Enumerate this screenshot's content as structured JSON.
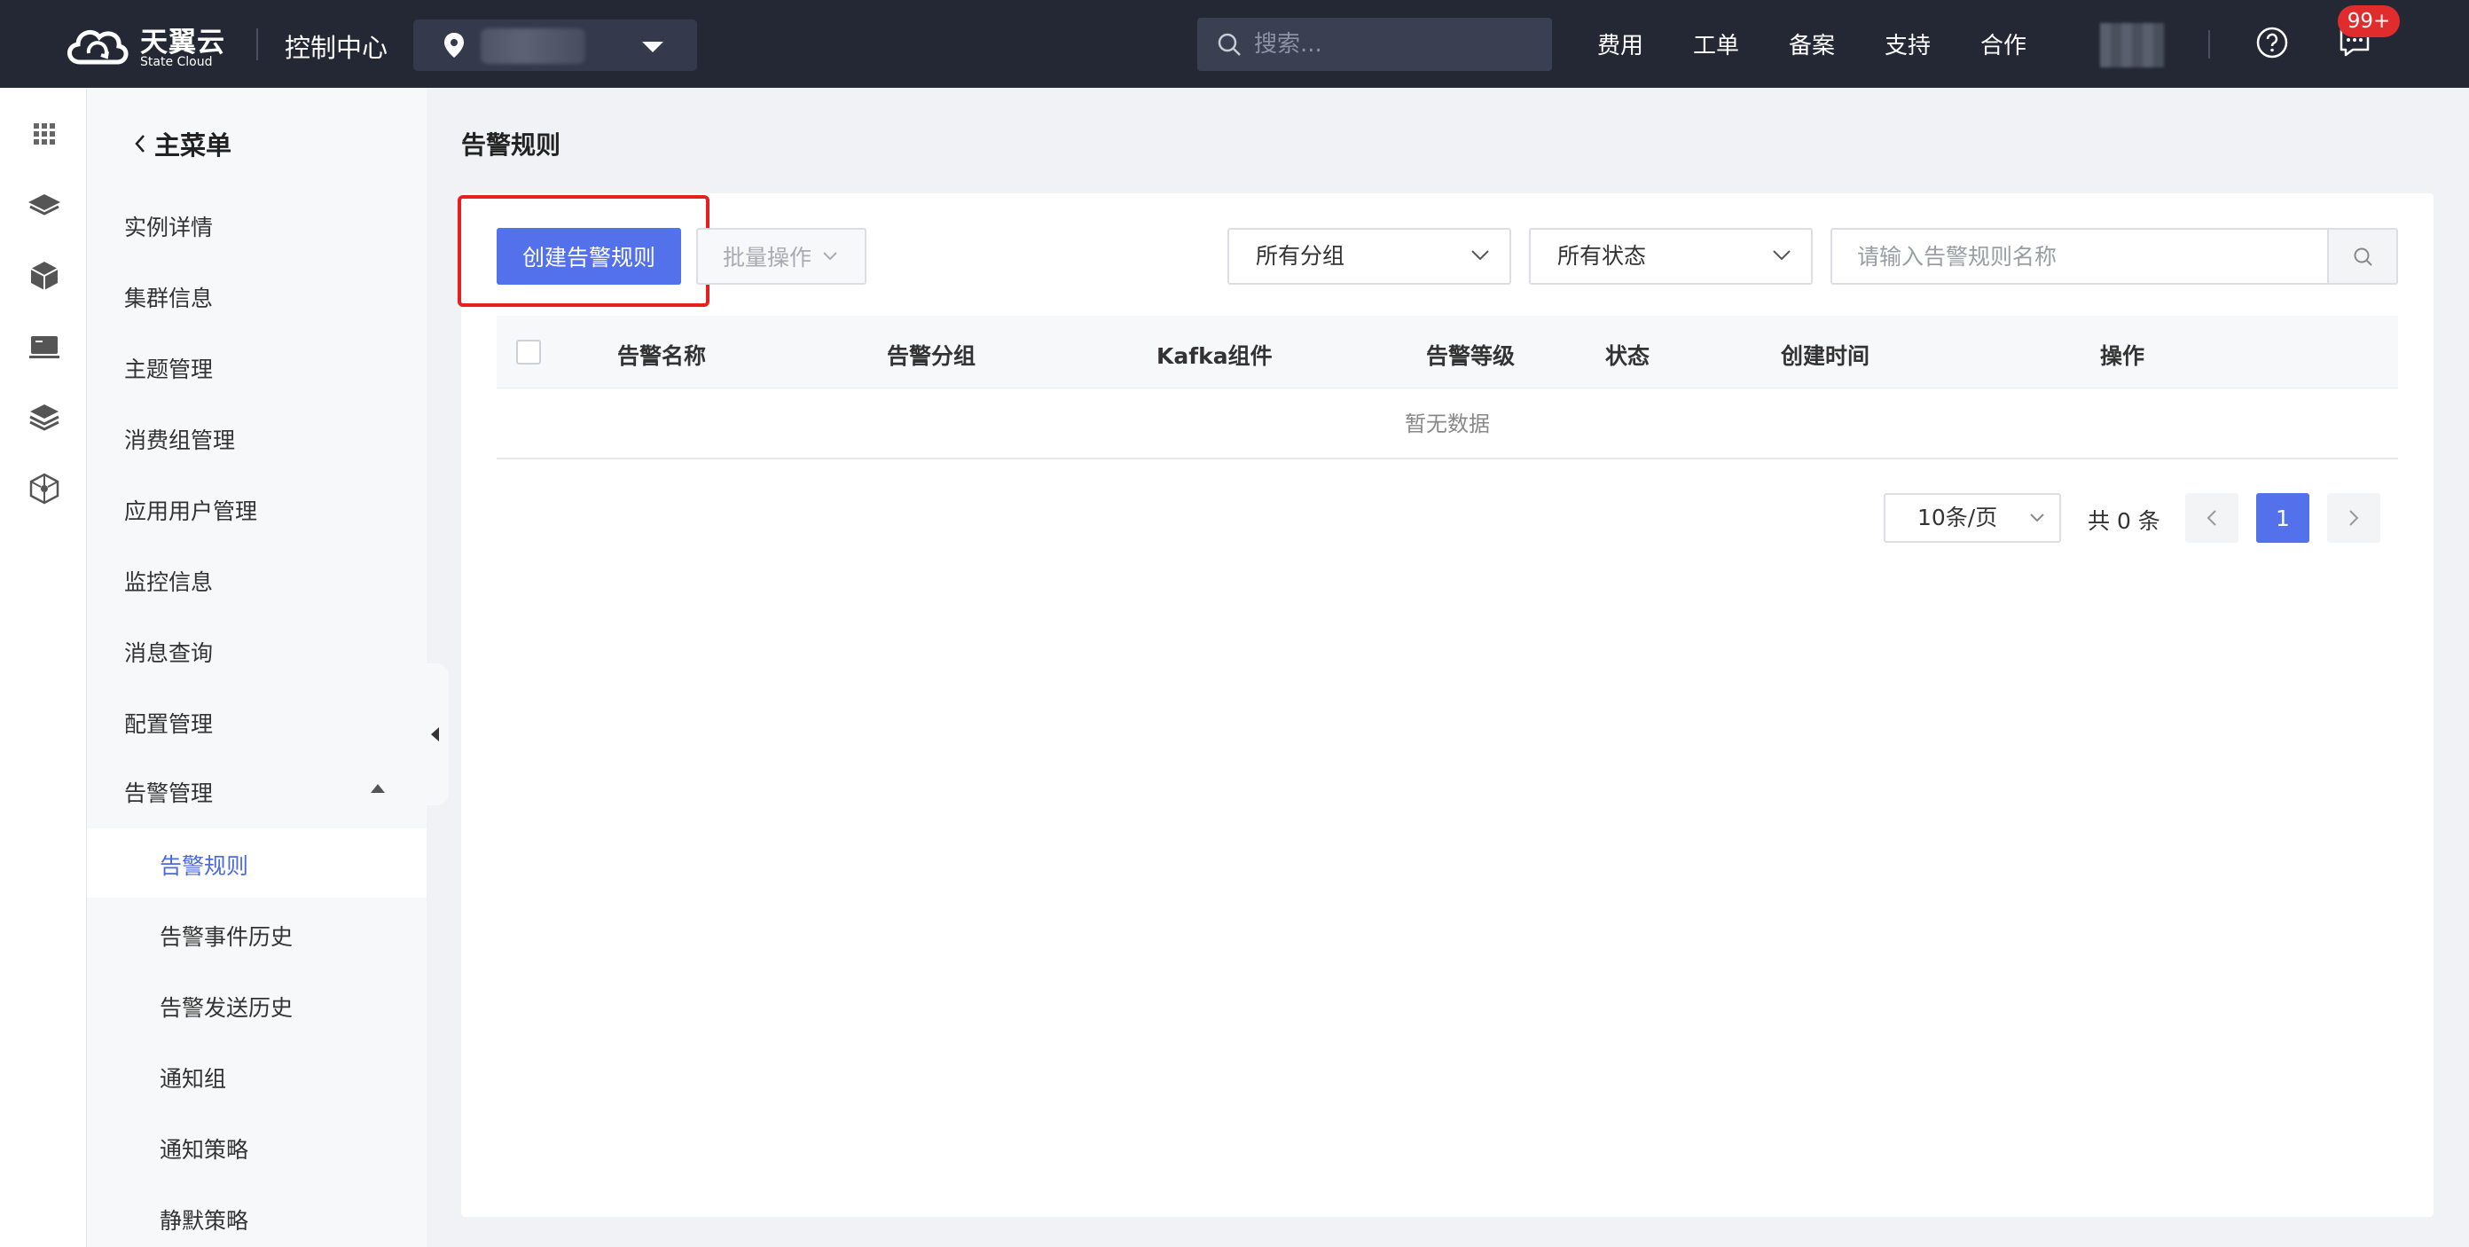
{
  "header": {
    "brand": "天翼云",
    "brand_sub": "State Cloud",
    "console_title": "控制中心",
    "search_placeholder": "搜索...",
    "nav": [
      "费用",
      "工单",
      "备案",
      "支持",
      "合作"
    ],
    "notification_badge": "99+"
  },
  "sidebar": {
    "back_label": "主菜单",
    "items": [
      "实例详情",
      "集群信息",
      "主题管理",
      "消费组管理",
      "应用用户管理",
      "监控信息",
      "消息查询",
      "配置管理",
      "告警管理"
    ],
    "sub_items": [
      "告警规则",
      "告警事件历史",
      "告警发送历史",
      "通知组",
      "通知策略",
      "静默策略"
    ],
    "active_sub": "告警规则"
  },
  "main": {
    "page_title": "告警规则",
    "create_button": "创建告警规则",
    "batch_button": "批量操作",
    "group_filter": "所有分组",
    "status_filter": "所有状态",
    "name_search_placeholder": "请输入告警规则名称",
    "table": {
      "columns": [
        "告警名称",
        "告警分组",
        "Kafka组件",
        "告警等级",
        "状态",
        "创建时间",
        "操作"
      ],
      "empty_text": "暂无数据"
    },
    "pagination": {
      "page_size": "10条/页",
      "total": "共 0 条",
      "current_page": "1"
    }
  },
  "colors": {
    "topbar": "#242834",
    "primary": "#5471ec",
    "highlight": "#e81f1f",
    "badge": "#e02c2c"
  },
  "icons": [
    "location-pin-icon",
    "search-icon",
    "help-icon",
    "message-icon",
    "apps-grid-icon",
    "layers-icon",
    "cube-icon",
    "monitor-icon",
    "stack-icon",
    "network-icon",
    "chevron-left-icon",
    "chevron-down-icon",
    "chevron-right-icon"
  ]
}
